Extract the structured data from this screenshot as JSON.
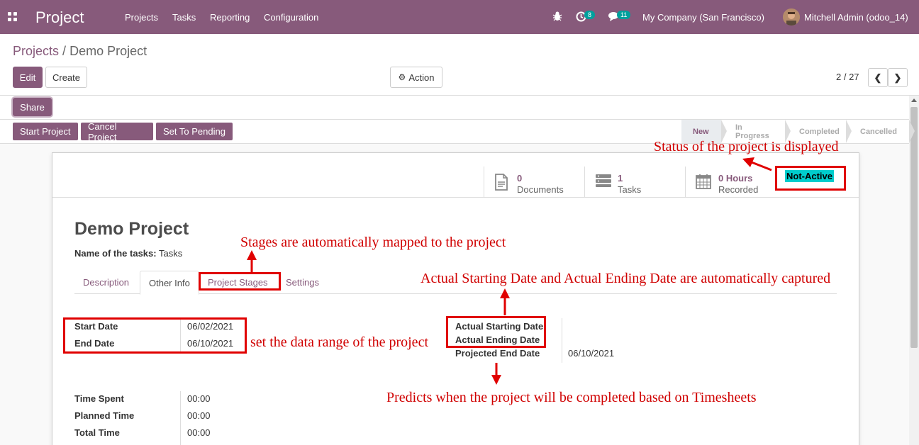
{
  "navbar": {
    "app_title": "Project",
    "menus": [
      "Projects",
      "Tasks",
      "Reporting",
      "Configuration"
    ],
    "activity_count": "8",
    "messages_count": "11",
    "company": "My Company (San Francisco)",
    "user": "Mitchell Admin (odoo_14)"
  },
  "breadcrumb": {
    "parent": "Projects",
    "separator": "/",
    "current": "Demo Project"
  },
  "buttons": {
    "edit": "Edit",
    "create": "Create",
    "action": "Action",
    "share": "Share"
  },
  "pager": {
    "value": "2 / 27"
  },
  "status_buttons": [
    "Start Project",
    "Cancel Project",
    "Set To Pending"
  ],
  "stages": [
    "New",
    "In Progress",
    "Completed",
    "Cancelled"
  ],
  "smart_buttons": [
    {
      "value": "0",
      "label": "Documents",
      "icon": "document-icon"
    },
    {
      "value": "1",
      "label": "Tasks",
      "icon": "tasks-icon"
    },
    {
      "value": "0 Hours",
      "label": "Recorded",
      "icon": "calendar-icon"
    }
  ],
  "status_badge": "Not-Active",
  "form": {
    "title": "Demo Project",
    "name_of_tasks_label": "Name of the tasks:",
    "name_of_tasks_value": "Tasks",
    "tabs": [
      "Description",
      "Other Info",
      "Project Stages",
      "Settings"
    ],
    "start_date_label": "Start Date",
    "start_date": "06/02/2021",
    "end_date_label": "End Date",
    "end_date": "06/10/2021",
    "actual_start_label": "Actual Starting Date",
    "actual_end_label": "Actual Ending Date",
    "projected_end_label": "Projected End Date",
    "projected_end": "06/10/2021",
    "time_spent_label": "Time Spent",
    "time_spent": "00:00",
    "planned_time_label": "Planned Time",
    "planned_time": "00:00",
    "total_time_label": "Total Time",
    "total_time": "00:00"
  },
  "annotations": {
    "status": "Status of the project is displayed",
    "stages": "Stages are automatically mapped to the project",
    "actual_dates": "Actual Starting Date and Actual Ending Date are automatically captured",
    "date_range": "set the data range of the project",
    "predicts": "Predicts when the project will be completed based on Timesheets"
  },
  "colors": {
    "brand": "#875a7b",
    "annotation": "#e00000",
    "badge": "#00cdcd"
  }
}
